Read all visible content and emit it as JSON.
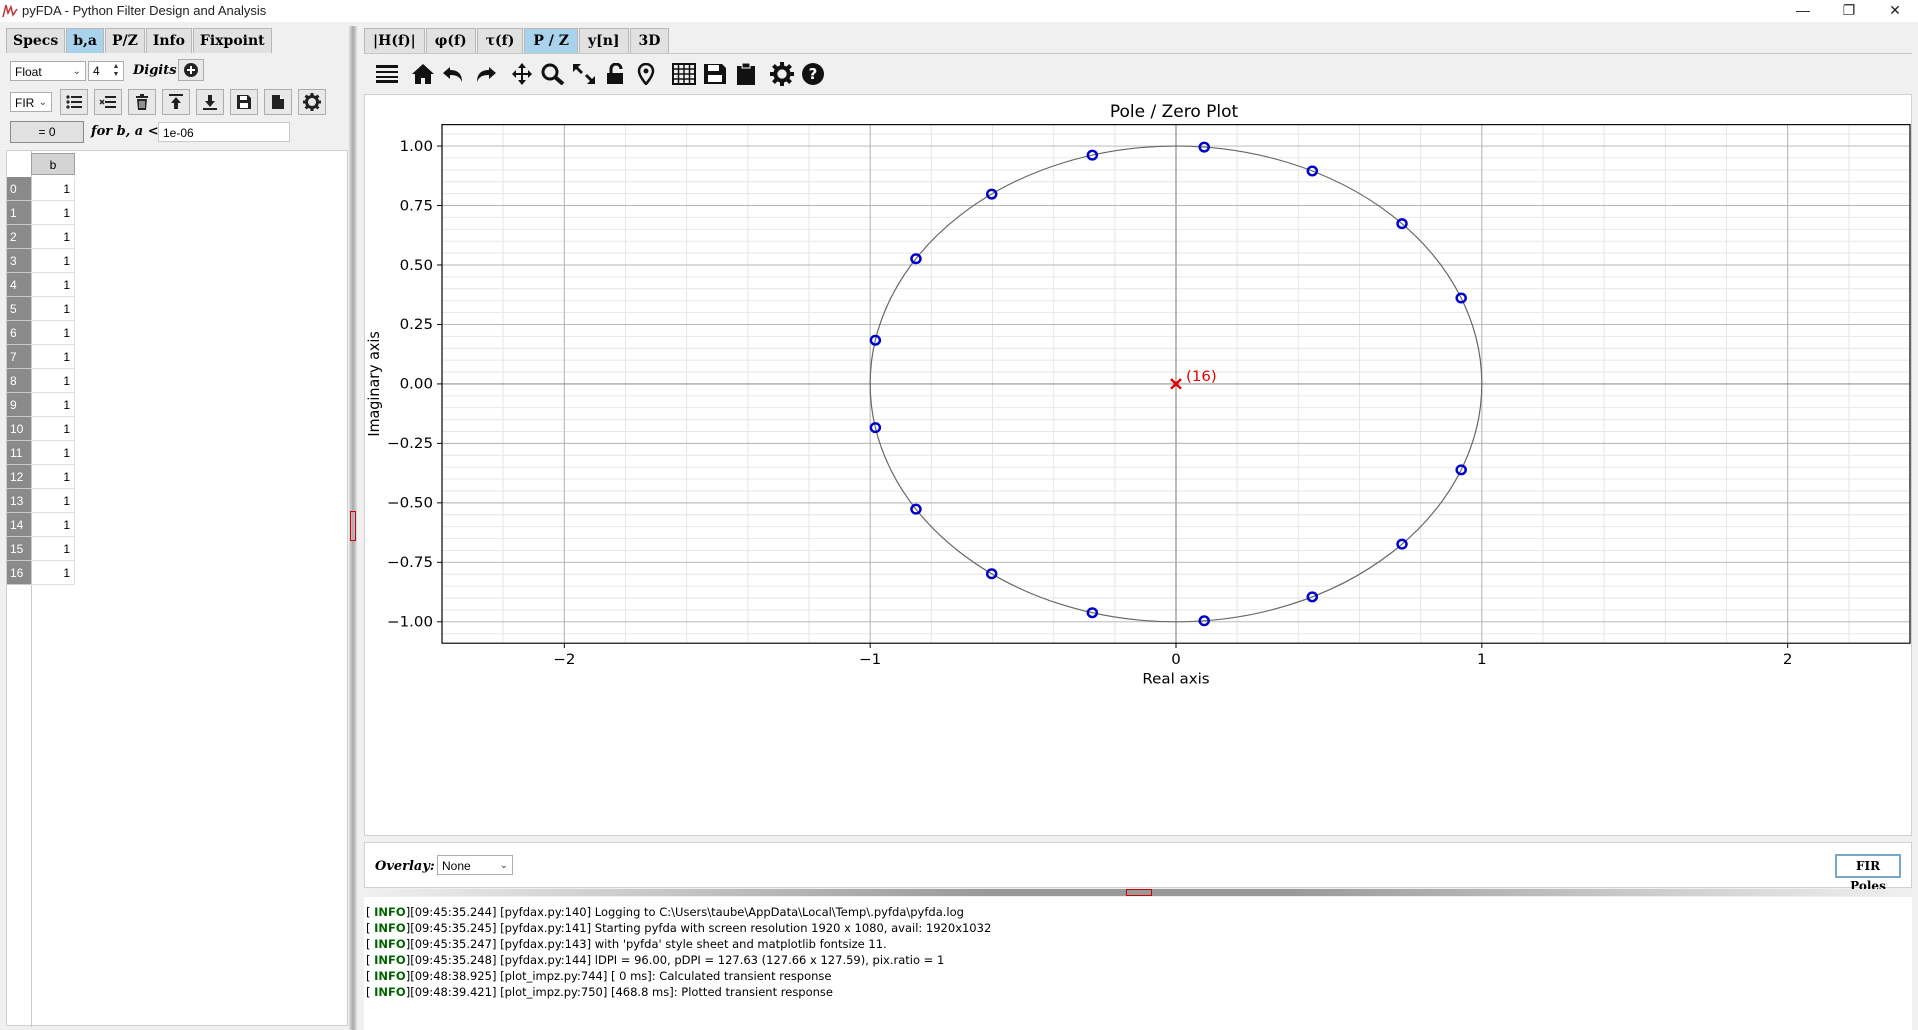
{
  "window": {
    "title": "pyFDA - Python Filter Design and Analysis"
  },
  "left_tabs": [
    "Specs",
    "b,a",
    "P/Z",
    "Info",
    "Fixpoint"
  ],
  "left_active_tab": "b,a",
  "coeffs": {
    "format_select": "Float",
    "digits_value": "4",
    "digits_label": "Digits",
    "filter_type_select": "FIR",
    "zero_button": "= 0",
    "tolerance_label": "for b, a <",
    "tolerance_value": "1e-06",
    "column_header": "b",
    "row_labels": [
      "0",
      "1",
      "2",
      "3",
      "4",
      "5",
      "6",
      "7",
      "8",
      "9",
      "10",
      "11",
      "12",
      "13",
      "14",
      "15",
      "16"
    ],
    "values": [
      "1",
      "1",
      "1",
      "1",
      "1",
      "1",
      "1",
      "1",
      "1",
      "1",
      "1",
      "1",
      "1",
      "1",
      "1",
      "1",
      "1"
    ]
  },
  "right_tabs": [
    "|H(f)|",
    "φ(f)",
    "τ(f)",
    "P / Z",
    "y[n]",
    "3D"
  ],
  "right_active_tab": "P / Z",
  "toolbar_icons": [
    "hamburger-icon",
    "home-icon",
    "undo-icon",
    "redo-icon",
    "pan-icon",
    "zoom-icon",
    "zoom-full-icon",
    "lock-icon",
    "marker-icon",
    "grid-icon",
    "save-icon",
    "clipboard-icon",
    "settings-icon",
    "help-icon"
  ],
  "overlay": {
    "label": "Overlay:",
    "value": "None"
  },
  "fir_poles_button": "FIR Poles",
  "log": [
    {
      "level": "INFO",
      "text": "[09:45:35.244] [pyfdax.py:140] Logging to C:\\Users\\taube\\AppData\\Local\\Temp\\.pyfda\\pyfda.log"
    },
    {
      "level": "INFO",
      "text": "[09:45:35.245] [pyfdax.py:141] Starting pyfda with screen resolution 1920 x 1080, avail: 1920x1032"
    },
    {
      "level": "INFO",
      "text": "[09:45:35.247] [pyfdax.py:143] with 'pyfda' style sheet and matplotlib fontsize 11."
    },
    {
      "level": "INFO",
      "text": "[09:45:35.248] [pyfdax.py:144] lDPI = 96.00, pDPI = 127.63 (127.66 x 127.59), pix.ratio = 1"
    },
    {
      "level": "INFO",
      "text": "[09:48:38.925] [plot_impz.py:744] [ 0 ms]: Calculated transient response"
    },
    {
      "level": "INFO",
      "text": "[09:48:39.421] [plot_impz.py:750] [468.8 ms]: Plotted transient response"
    }
  ],
  "chart_data": {
    "type": "scatter",
    "title": "Pole / Zero Plot",
    "xlabel": "Real axis",
    "ylabel": "Imaginary axis",
    "xlim": [
      -2.4,
      2.4
    ],
    "ylim": [
      -1.09,
      1.09
    ],
    "x_ticks": [
      -2,
      -1,
      0,
      1,
      2
    ],
    "x_tick_labels": [
      "−2",
      "−1",
      "0",
      "1",
      "2"
    ],
    "y_ticks": [
      1.0,
      0.75,
      0.5,
      0.25,
      0.0,
      -0.25,
      -0.5,
      -0.75,
      -1.0
    ],
    "y_tick_labels": [
      "1.00",
      "0.75",
      "0.50",
      "0.25",
      "0.00",
      "−0.25",
      "−0.50",
      "−0.75",
      "−1.00"
    ],
    "grid": true,
    "unit_circle": true,
    "series": [
      {
        "marker": "o",
        "color": "#0000cc",
        "x": [
          0.0923,
          0.4457,
          0.739,
          0.9325,
          0.9325,
          0.739,
          0.4457,
          0.0923,
          -0.2736,
          -0.6026,
          -0.8502,
          -0.983,
          -0.983,
          -0.8502,
          -0.6026,
          -0.2736
        ],
        "y": [
          0.9957,
          0.8952,
          0.6737,
          0.3612,
          -0.3612,
          -0.6737,
          -0.8952,
          -0.9957,
          -0.9618,
          -0.798,
          -0.5264,
          -0.1837,
          0.1837,
          0.5264,
          0.798,
          0.9618
        ]
      },
      {
        "marker": "x",
        "color": "#e00000",
        "x": [
          0
        ],
        "y": [
          0
        ]
      }
    ],
    "annotations": [
      {
        "text": "(16)",
        "x": 0,
        "y": 0,
        "color": "#e00000"
      }
    ]
  }
}
